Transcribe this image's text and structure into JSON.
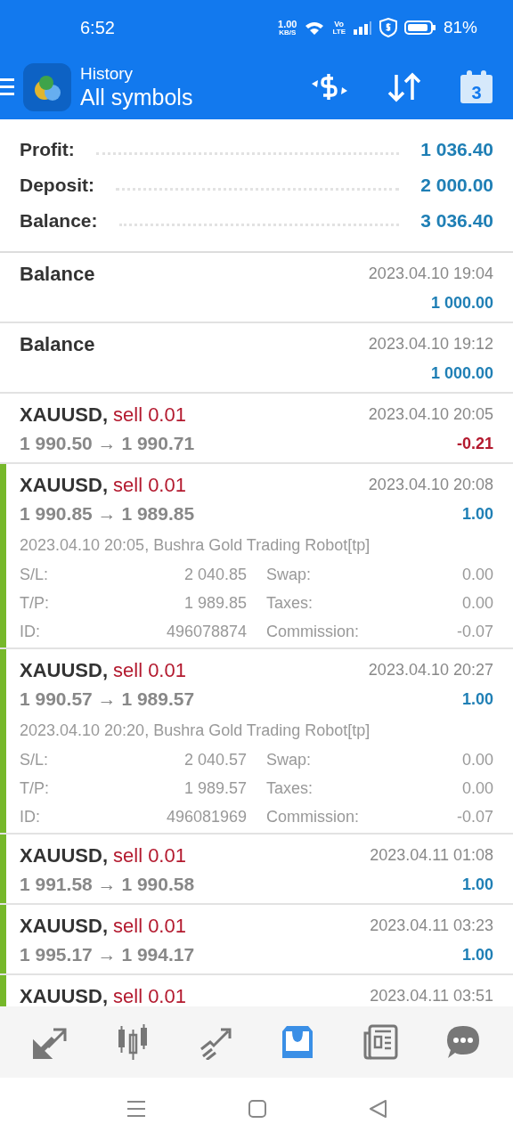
{
  "status_bar": {
    "time": "6:52",
    "speed": "1.00",
    "speed_unit": "KB/S",
    "volte": "Vo",
    "lte": "LTE",
    "battery": "81%"
  },
  "header": {
    "subtitle": "History",
    "title": "All symbols",
    "calendar_day": "3"
  },
  "summary": [
    {
      "label": "Profit:",
      "value": "1 036.40"
    },
    {
      "label": "Deposit:",
      "value": "2 000.00"
    },
    {
      "label": "Balance:",
      "value": "3 036.40"
    }
  ],
  "rows": [
    {
      "kind": "balance",
      "accent_bar": false,
      "title": "Balance",
      "time": "2023.04.10 19:04",
      "profit": "1 000.00",
      "color": "#1f7fb5"
    },
    {
      "kind": "balance",
      "accent_bar": false,
      "title": "Balance",
      "time": "2023.04.10 19:12",
      "profit": "1 000.00",
      "color": "#1f7fb5"
    },
    {
      "kind": "deal",
      "accent_bar": false,
      "symbol": "XAUUSD,",
      "side": "sell 0.01",
      "time": "2023.04.10 20:05",
      "prices": "1 990.50 → 1 990.71",
      "profit": "-0.21",
      "color": "#b3192e"
    },
    {
      "kind": "deal",
      "accent_bar": true,
      "symbol": "XAUUSD,",
      "side": "sell 0.01",
      "time": "2023.04.10 20:08",
      "prices": "1 990.85 → 1 989.85",
      "profit": "1.00",
      "color": "#1f7fb5",
      "comment": "2023.04.10 20:05, Bushra Gold Trading Robot[tp]",
      "details": [
        [
          "S/L:",
          "2 040.85",
          "Swap:",
          "0.00"
        ],
        [
          "T/P:",
          "1 989.85",
          "Taxes:",
          "0.00"
        ],
        [
          "ID:",
          "496078874",
          "Commission:",
          "-0.07"
        ]
      ]
    },
    {
      "kind": "deal",
      "accent_bar": true,
      "symbol": "XAUUSD,",
      "side": "sell 0.01",
      "time": "2023.04.10 20:27",
      "prices": "1 990.57 → 1 989.57",
      "profit": "1.00",
      "color": "#1f7fb5",
      "comment": "2023.04.10 20:20, Bushra Gold Trading Robot[tp]",
      "details": [
        [
          "S/L:",
          "2 040.57",
          "Swap:",
          "0.00"
        ],
        [
          "T/P:",
          "1 989.57",
          "Taxes:",
          "0.00"
        ],
        [
          "ID:",
          "496081969",
          "Commission:",
          "-0.07"
        ]
      ]
    },
    {
      "kind": "deal",
      "accent_bar": true,
      "symbol": "XAUUSD,",
      "side": "sell 0.01",
      "time": "2023.04.11 01:08",
      "prices": "1 991.58 → 1 990.58",
      "profit": "1.00",
      "color": "#1f7fb5"
    },
    {
      "kind": "deal",
      "accent_bar": true,
      "symbol": "XAUUSD,",
      "side": "sell 0.01",
      "time": "2023.04.11 03:23",
      "prices": "1 995.17 → 1 994.17",
      "profit": "1.00",
      "color": "#1f7fb5"
    },
    {
      "kind": "partial",
      "accent_bar": true,
      "symbol": "XAUUSD,",
      "side": "sell 0.01",
      "time": "2023.04.11 03:51"
    }
  ],
  "bottom_nav": [
    {
      "kind": "trade",
      "selected": false
    },
    {
      "kind": "chart",
      "selected": false
    },
    {
      "kind": "trend",
      "selected": false
    },
    {
      "kind": "history",
      "selected": true
    },
    {
      "kind": "news",
      "selected": false
    },
    {
      "kind": "chat",
      "selected": false
    }
  ]
}
